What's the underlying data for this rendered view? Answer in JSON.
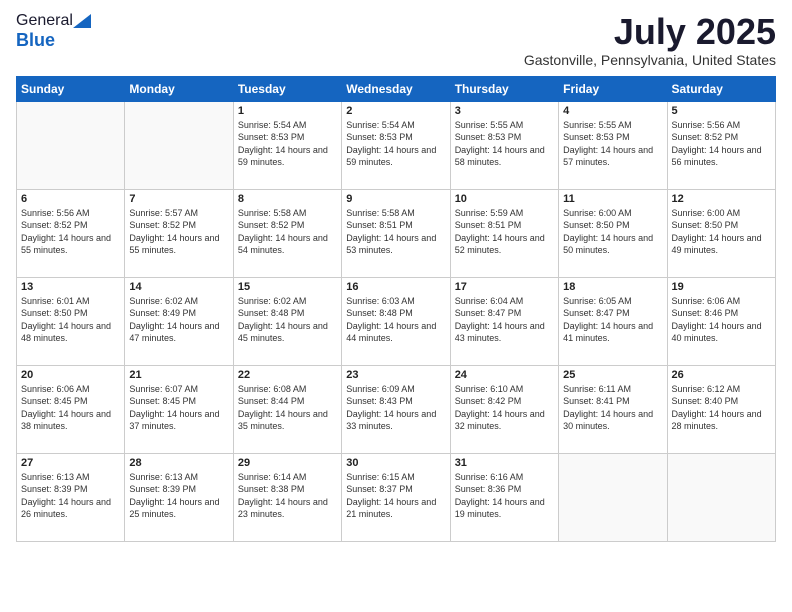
{
  "header": {
    "logo_general": "General",
    "logo_blue": "Blue",
    "month_title": "July 2025",
    "location": "Gastonville, Pennsylvania, United States"
  },
  "days_of_week": [
    "Sunday",
    "Monday",
    "Tuesday",
    "Wednesday",
    "Thursday",
    "Friday",
    "Saturday"
  ],
  "weeks": [
    [
      {
        "day": "",
        "sunrise": "",
        "sunset": "",
        "daylight": ""
      },
      {
        "day": "",
        "sunrise": "",
        "sunset": "",
        "daylight": ""
      },
      {
        "day": "1",
        "sunrise": "Sunrise: 5:54 AM",
        "sunset": "Sunset: 8:53 PM",
        "daylight": "Daylight: 14 hours and 59 minutes."
      },
      {
        "day": "2",
        "sunrise": "Sunrise: 5:54 AM",
        "sunset": "Sunset: 8:53 PM",
        "daylight": "Daylight: 14 hours and 59 minutes."
      },
      {
        "day": "3",
        "sunrise": "Sunrise: 5:55 AM",
        "sunset": "Sunset: 8:53 PM",
        "daylight": "Daylight: 14 hours and 58 minutes."
      },
      {
        "day": "4",
        "sunrise": "Sunrise: 5:55 AM",
        "sunset": "Sunset: 8:53 PM",
        "daylight": "Daylight: 14 hours and 57 minutes."
      },
      {
        "day": "5",
        "sunrise": "Sunrise: 5:56 AM",
        "sunset": "Sunset: 8:52 PM",
        "daylight": "Daylight: 14 hours and 56 minutes."
      }
    ],
    [
      {
        "day": "6",
        "sunrise": "Sunrise: 5:56 AM",
        "sunset": "Sunset: 8:52 PM",
        "daylight": "Daylight: 14 hours and 55 minutes."
      },
      {
        "day": "7",
        "sunrise": "Sunrise: 5:57 AM",
        "sunset": "Sunset: 8:52 PM",
        "daylight": "Daylight: 14 hours and 55 minutes."
      },
      {
        "day": "8",
        "sunrise": "Sunrise: 5:58 AM",
        "sunset": "Sunset: 8:52 PM",
        "daylight": "Daylight: 14 hours and 54 minutes."
      },
      {
        "day": "9",
        "sunrise": "Sunrise: 5:58 AM",
        "sunset": "Sunset: 8:51 PM",
        "daylight": "Daylight: 14 hours and 53 minutes."
      },
      {
        "day": "10",
        "sunrise": "Sunrise: 5:59 AM",
        "sunset": "Sunset: 8:51 PM",
        "daylight": "Daylight: 14 hours and 52 minutes."
      },
      {
        "day": "11",
        "sunrise": "Sunrise: 6:00 AM",
        "sunset": "Sunset: 8:50 PM",
        "daylight": "Daylight: 14 hours and 50 minutes."
      },
      {
        "day": "12",
        "sunrise": "Sunrise: 6:00 AM",
        "sunset": "Sunset: 8:50 PM",
        "daylight": "Daylight: 14 hours and 49 minutes."
      }
    ],
    [
      {
        "day": "13",
        "sunrise": "Sunrise: 6:01 AM",
        "sunset": "Sunset: 8:50 PM",
        "daylight": "Daylight: 14 hours and 48 minutes."
      },
      {
        "day": "14",
        "sunrise": "Sunrise: 6:02 AM",
        "sunset": "Sunset: 8:49 PM",
        "daylight": "Daylight: 14 hours and 47 minutes."
      },
      {
        "day": "15",
        "sunrise": "Sunrise: 6:02 AM",
        "sunset": "Sunset: 8:48 PM",
        "daylight": "Daylight: 14 hours and 45 minutes."
      },
      {
        "day": "16",
        "sunrise": "Sunrise: 6:03 AM",
        "sunset": "Sunset: 8:48 PM",
        "daylight": "Daylight: 14 hours and 44 minutes."
      },
      {
        "day": "17",
        "sunrise": "Sunrise: 6:04 AM",
        "sunset": "Sunset: 8:47 PM",
        "daylight": "Daylight: 14 hours and 43 minutes."
      },
      {
        "day": "18",
        "sunrise": "Sunrise: 6:05 AM",
        "sunset": "Sunset: 8:47 PM",
        "daylight": "Daylight: 14 hours and 41 minutes."
      },
      {
        "day": "19",
        "sunrise": "Sunrise: 6:06 AM",
        "sunset": "Sunset: 8:46 PM",
        "daylight": "Daylight: 14 hours and 40 minutes."
      }
    ],
    [
      {
        "day": "20",
        "sunrise": "Sunrise: 6:06 AM",
        "sunset": "Sunset: 8:45 PM",
        "daylight": "Daylight: 14 hours and 38 minutes."
      },
      {
        "day": "21",
        "sunrise": "Sunrise: 6:07 AM",
        "sunset": "Sunset: 8:45 PM",
        "daylight": "Daylight: 14 hours and 37 minutes."
      },
      {
        "day": "22",
        "sunrise": "Sunrise: 6:08 AM",
        "sunset": "Sunset: 8:44 PM",
        "daylight": "Daylight: 14 hours and 35 minutes."
      },
      {
        "day": "23",
        "sunrise": "Sunrise: 6:09 AM",
        "sunset": "Sunset: 8:43 PM",
        "daylight": "Daylight: 14 hours and 33 minutes."
      },
      {
        "day": "24",
        "sunrise": "Sunrise: 6:10 AM",
        "sunset": "Sunset: 8:42 PM",
        "daylight": "Daylight: 14 hours and 32 minutes."
      },
      {
        "day": "25",
        "sunrise": "Sunrise: 6:11 AM",
        "sunset": "Sunset: 8:41 PM",
        "daylight": "Daylight: 14 hours and 30 minutes."
      },
      {
        "day": "26",
        "sunrise": "Sunrise: 6:12 AM",
        "sunset": "Sunset: 8:40 PM",
        "daylight": "Daylight: 14 hours and 28 minutes."
      }
    ],
    [
      {
        "day": "27",
        "sunrise": "Sunrise: 6:13 AM",
        "sunset": "Sunset: 8:39 PM",
        "daylight": "Daylight: 14 hours and 26 minutes."
      },
      {
        "day": "28",
        "sunrise": "Sunrise: 6:13 AM",
        "sunset": "Sunset: 8:39 PM",
        "daylight": "Daylight: 14 hours and 25 minutes."
      },
      {
        "day": "29",
        "sunrise": "Sunrise: 6:14 AM",
        "sunset": "Sunset: 8:38 PM",
        "daylight": "Daylight: 14 hours and 23 minutes."
      },
      {
        "day": "30",
        "sunrise": "Sunrise: 6:15 AM",
        "sunset": "Sunset: 8:37 PM",
        "daylight": "Daylight: 14 hours and 21 minutes."
      },
      {
        "day": "31",
        "sunrise": "Sunrise: 6:16 AM",
        "sunset": "Sunset: 8:36 PM",
        "daylight": "Daylight: 14 hours and 19 minutes."
      },
      {
        "day": "",
        "sunrise": "",
        "sunset": "",
        "daylight": ""
      },
      {
        "day": "",
        "sunrise": "",
        "sunset": "",
        "daylight": ""
      }
    ]
  ]
}
